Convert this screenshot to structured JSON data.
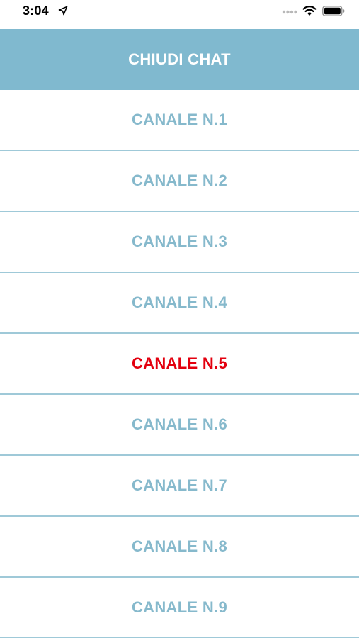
{
  "status_bar": {
    "time": "3:04",
    "icons": [
      "location-arrow-icon",
      "signal-dots-icon",
      "wifi-icon",
      "battery-icon"
    ]
  },
  "header": {
    "close_chat_label": "CHIUDI CHAT"
  },
  "channels": {
    "items": [
      {
        "label": "CANALE N.1",
        "active": false
      },
      {
        "label": "CANALE N.2",
        "active": false
      },
      {
        "label": "CANALE N.3",
        "active": false
      },
      {
        "label": "CANALE N.4",
        "active": false
      },
      {
        "label": "CANALE N.5",
        "active": true
      },
      {
        "label": "CANALE N.6",
        "active": false
      },
      {
        "label": "CANALE N.7",
        "active": false
      },
      {
        "label": "CANALE N.8",
        "active": false
      },
      {
        "label": "CANALE N.9",
        "active": false
      }
    ]
  },
  "colors": {
    "header_bg": "#80b9cf",
    "channel_text": "#86b9cc",
    "active_channel_text": "#e3000f",
    "divider": "#9fc9d8"
  }
}
